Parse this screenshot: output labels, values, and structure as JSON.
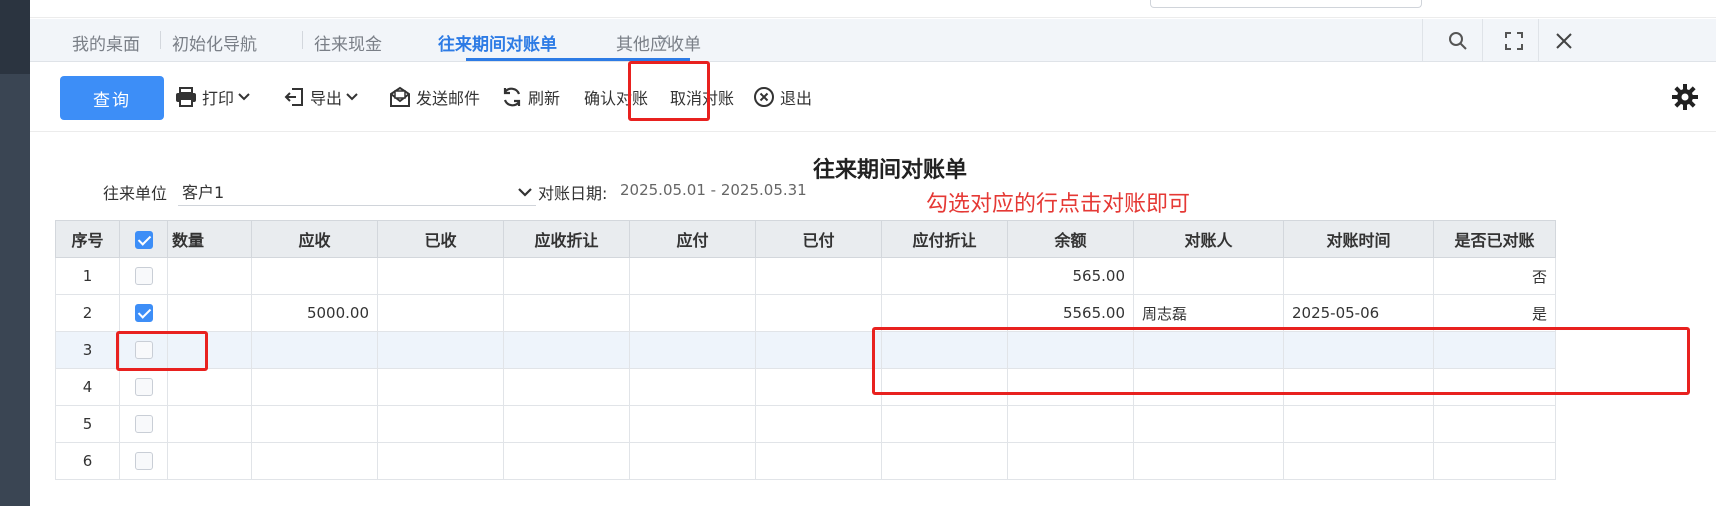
{
  "tabs": [
    {
      "label": "我的桌面",
      "active": false
    },
    {
      "label": "初始化导航",
      "active": false
    },
    {
      "label": "往来现金",
      "active": false
    },
    {
      "label": "往来期间对账单",
      "active": true
    },
    {
      "label": "其他应收单",
      "active": false
    }
  ],
  "tab_close_glyph": "×",
  "window_icons": [
    "search-icon",
    "fullscreen-icon",
    "close-icon"
  ],
  "toolbar": {
    "query": "查询",
    "print": "打印",
    "export": "导出",
    "email": "发送邮件",
    "refresh": "刷新",
    "confirm": "确认对账",
    "cancel": "取消对账",
    "exit": "退出"
  },
  "doc": {
    "title": "往来期间对账单",
    "partner_label": "往来单位",
    "partner_value": "客户1",
    "date_label": "对账日期:",
    "date_value": "2025.05.01 - 2025.05.31",
    "hint": "勾选对应的行点击对账即可"
  },
  "columns": [
    "序号",
    "",
    "数量",
    "应收",
    "已收",
    "应收折让",
    "应付",
    "已付",
    "应付折让",
    "余额",
    "对账人",
    "对账时间",
    "是否已对账"
  ],
  "rows": [
    {
      "idx": "1",
      "checked": false,
      "qty": "",
      "receivable": "",
      "received": "",
      "recv_discount": "",
      "payable": "",
      "paid": "",
      "pay_discount": "",
      "balance": "565.00",
      "reconciler": "",
      "time": "",
      "reconciled": "否"
    },
    {
      "idx": "2",
      "checked": true,
      "qty": "",
      "receivable": "5000.00",
      "received": "",
      "recv_discount": "",
      "payable": "",
      "paid": "",
      "pay_discount": "",
      "balance": "5565.00",
      "reconciler": "周志磊",
      "time": "2025-05-06",
      "reconciled": "是"
    },
    {
      "idx": "3",
      "checked": false,
      "qty": "",
      "receivable": "",
      "received": "",
      "recv_discount": "",
      "payable": "",
      "paid": "",
      "pay_discount": "",
      "balance": "",
      "reconciler": "",
      "time": "",
      "reconciled": ""
    },
    {
      "idx": "4",
      "checked": false,
      "qty": "",
      "receivable": "",
      "received": "",
      "recv_discount": "",
      "payable": "",
      "paid": "",
      "pay_discount": "",
      "balance": "",
      "reconciler": "",
      "time": "",
      "reconciled": ""
    },
    {
      "idx": "5",
      "checked": false,
      "qty": "",
      "receivable": "",
      "received": "",
      "recv_discount": "",
      "payable": "",
      "paid": "",
      "pay_discount": "",
      "balance": "",
      "reconciler": "",
      "time": "",
      "reconciled": ""
    },
    {
      "idx": "6",
      "checked": false,
      "qty": "",
      "receivable": "",
      "received": "",
      "recv_discount": "",
      "payable": "",
      "paid": "",
      "pay_discount": "",
      "balance": "",
      "reconciler": "",
      "time": "",
      "reconciled": ""
    }
  ],
  "header_checked": true,
  "colors": {
    "accent": "#3d8ef7",
    "tab_active": "#2d7be5",
    "annotation": "#e8211f"
  }
}
